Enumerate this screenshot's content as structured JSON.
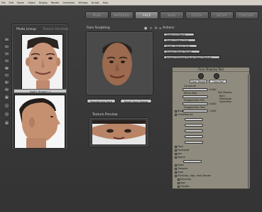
{
  "menu": [
    "File",
    "Edit",
    "Figure",
    "Object",
    "Display",
    "Render",
    "Animation",
    "Window",
    "Scripts",
    "Help"
  ],
  "tabs": [
    "POSE",
    "MATERIAL",
    "FACE",
    "HAIR",
    "CLOTH",
    "SETUP",
    "CONTENT"
  ],
  "active_tab": "FACE",
  "left_panel": {
    "tab_photo": "Photo Lineup",
    "tab_texture": "Texture Variation",
    "apply_shape": "Apply Shape  [ ]"
  },
  "face_sculpting": {
    "title": "Face Sculpting",
    "randomize": "Randomize Face",
    "reset": "Reset Face Shape"
  },
  "texture_preview": {
    "title": "Texture Preview"
  },
  "actions": {
    "title": "Actions",
    "buttons": [
      "Apply to Figure",
      "Apply Shape Only",
      "Apply Texture Only",
      "Spawn Morph Target",
      "Import Original Figure Head Texture"
    ]
  },
  "fst": {
    "title": "Face Shaping Tool",
    "caricature_label": "Caricature",
    "ethnic_bias_label": "Ethnic Bias",
    "exaggeration_min_label": "Exaggeration Min",
    "exaggeration_max_label": "Exaggeration Max",
    "value_0": "0.000",
    "value_1": "1.000",
    "see_morphs": "See Morphs",
    "radio_1": "Both",
    "radio_2": "Heterosim",
    "radio_3": "Symmetry",
    "tree": [
      "Brow",
      "Cheekbones",
      "Face",
      "Forehead",
      "Jaw",
      "Mouth",
      "Nose",
      "Temples",
      "Eyes",
      "Ethnicity, Age, and Gender",
      "Ethnicity",
      "Age",
      "Gender"
    ],
    "star_buttons": [
      "Clear Morph",
      "Clear Ref"
    ]
  }
}
